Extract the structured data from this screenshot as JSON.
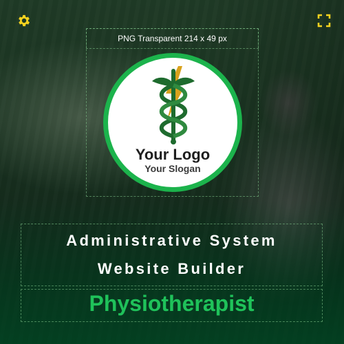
{
  "toolbar": {
    "settings_icon": "gear-icon",
    "fullscreen_icon": "fullscreen-icon"
  },
  "logo_area": {
    "label": "PNG Transparent 214 x 49 px",
    "logo_title": "Your Logo",
    "logo_slogan": "Your Slogan"
  },
  "headline": {
    "line1": "Administrative System",
    "line2": "Website Builder"
  },
  "brand": {
    "name": "Physiotherapist"
  },
  "colors": {
    "accent_yellow": "#f5d21f",
    "brand_green": "#1fc25a",
    "ring_green": "#1cb34c",
    "caduceus_green": "#1e6b2e",
    "bolt_gold": "#d9a21c"
  }
}
